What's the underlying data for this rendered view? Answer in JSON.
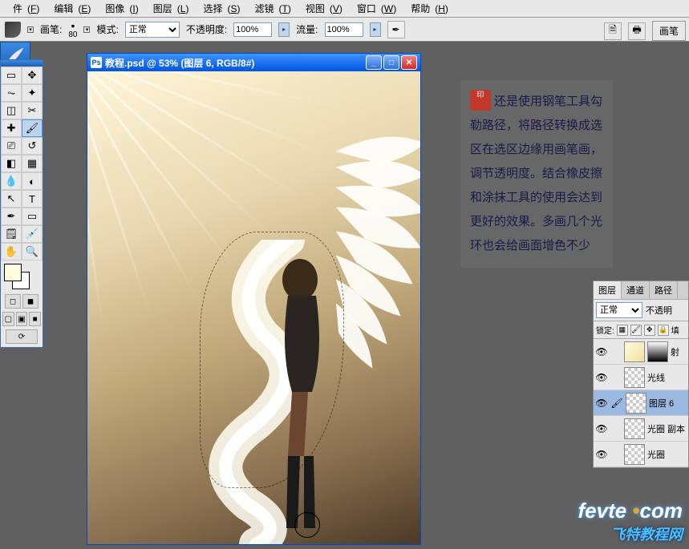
{
  "menubar": {
    "items": [
      {
        "label": "件",
        "key": "F"
      },
      {
        "label": "编辑",
        "key": "E"
      },
      {
        "label": "图像",
        "key": "I"
      },
      {
        "label": "图层",
        "key": "L"
      },
      {
        "label": "选择",
        "key": "S"
      },
      {
        "label": "滤镜",
        "key": "T"
      },
      {
        "label": "视图",
        "key": "V"
      },
      {
        "label": "窗口",
        "key": "W"
      },
      {
        "label": "帮助",
        "key": "H"
      }
    ]
  },
  "optionsbar": {
    "brush_label": "画笔:",
    "brush_size": "80",
    "mode_label": "模式:",
    "mode_value": "正常",
    "opacity_label": "不透明度:",
    "opacity_value": "100%",
    "flow_label": "流量:",
    "flow_value": "100%",
    "palette_label": "画笔"
  },
  "document": {
    "title": "教程.psd @ 53% (图层 6, RGB/8#)"
  },
  "instruction": {
    "text": "还是使用钢笔工具勾勒路径，将路径转换成选区在选区边缘用画笔画，调节透明度。结合橡皮擦和涂抹工具的使用会达到更好的效果。多画几个光环也会给画面增色不少"
  },
  "layers_panel": {
    "tabs": [
      "图层",
      "通道",
      "路径"
    ],
    "blend_mode": "正常",
    "opacity_label": "不透明",
    "lock_label": "锁定:",
    "fill_label": "填",
    "layers": [
      {
        "name": "射",
        "thumb": "yellow",
        "mask": true
      },
      {
        "name": "光线",
        "thumb": "checker"
      },
      {
        "name": "图层 6",
        "thumb": "checker",
        "selected": true,
        "brush": true
      },
      {
        "name": "光圈 副本",
        "thumb": "checker"
      },
      {
        "name": "光圈",
        "thumb": "checker"
      }
    ]
  },
  "watermark": {
    "url_a": "fevte",
    "url_b": "com",
    "subtitle": "飞特教程网"
  },
  "tools": [
    "▭",
    "⤢",
    "◫",
    "✂",
    "✎",
    "🖌",
    "⌫",
    "◢",
    "✏",
    "⬡",
    "△",
    "●",
    "🅰",
    "T",
    "↖",
    "⬚",
    "✋",
    "🔍"
  ]
}
